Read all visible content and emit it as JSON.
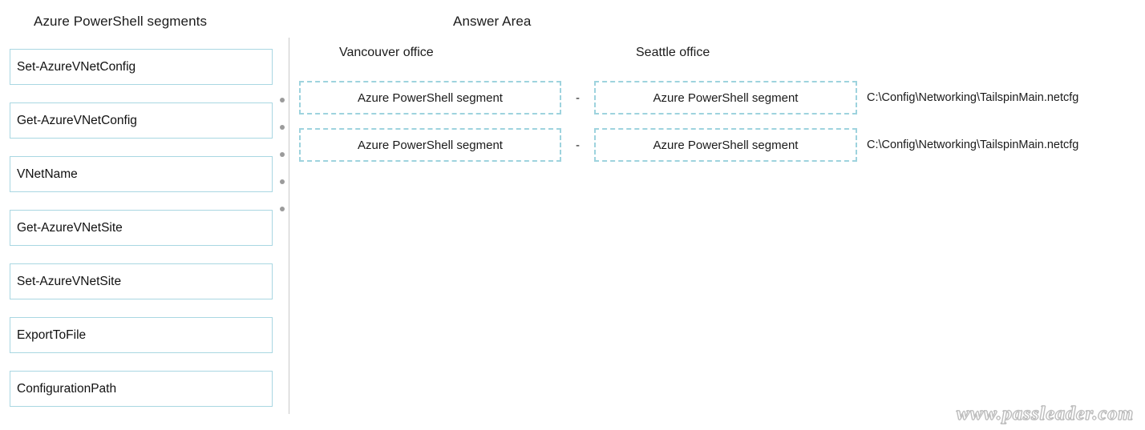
{
  "page": {
    "segments_title": "Azure PowerShell segments",
    "answer_title": "Answer Area",
    "watermark": "www.passleader.com"
  },
  "colors": {
    "source_box_border": "#a9d7e2",
    "drop_slot_border": "#9ed3de",
    "divider": "#c9c9c9",
    "rail_dot": "#9b9b9b",
    "text": "#1b1b1b",
    "background": "#ffffff"
  },
  "source_panel": {
    "title": "Azure PowerShell segments",
    "items": [
      {
        "label": "Set-AzureVNetConfig"
      },
      {
        "label": "Get-AzureVNetConfig"
      },
      {
        "label": "VNetName"
      },
      {
        "label": "Get-AzureVNetSite"
      },
      {
        "label": "Set-AzureVNetSite"
      },
      {
        "label": "ExportToFile"
      },
      {
        "label": "ConfigurationPath"
      }
    ]
  },
  "answer_area": {
    "title": "Answer Area",
    "columns": [
      {
        "label": "Vancouver office"
      },
      {
        "label": "Seattle office"
      }
    ],
    "rows": [
      {
        "left_slot": "Azure PowerShell segment",
        "separator": "-",
        "right_slot": "Azure PowerShell segment",
        "path": "C:\\Config\\Networking\\TailspinMain.netcfg"
      },
      {
        "left_slot": "Azure PowerShell segment",
        "separator": "-",
        "right_slot": "Azure PowerShell segment",
        "path": "C:\\Config\\Networking\\TailspinMain.netcfg"
      }
    ]
  },
  "rail": {
    "dot_count": 5
  }
}
